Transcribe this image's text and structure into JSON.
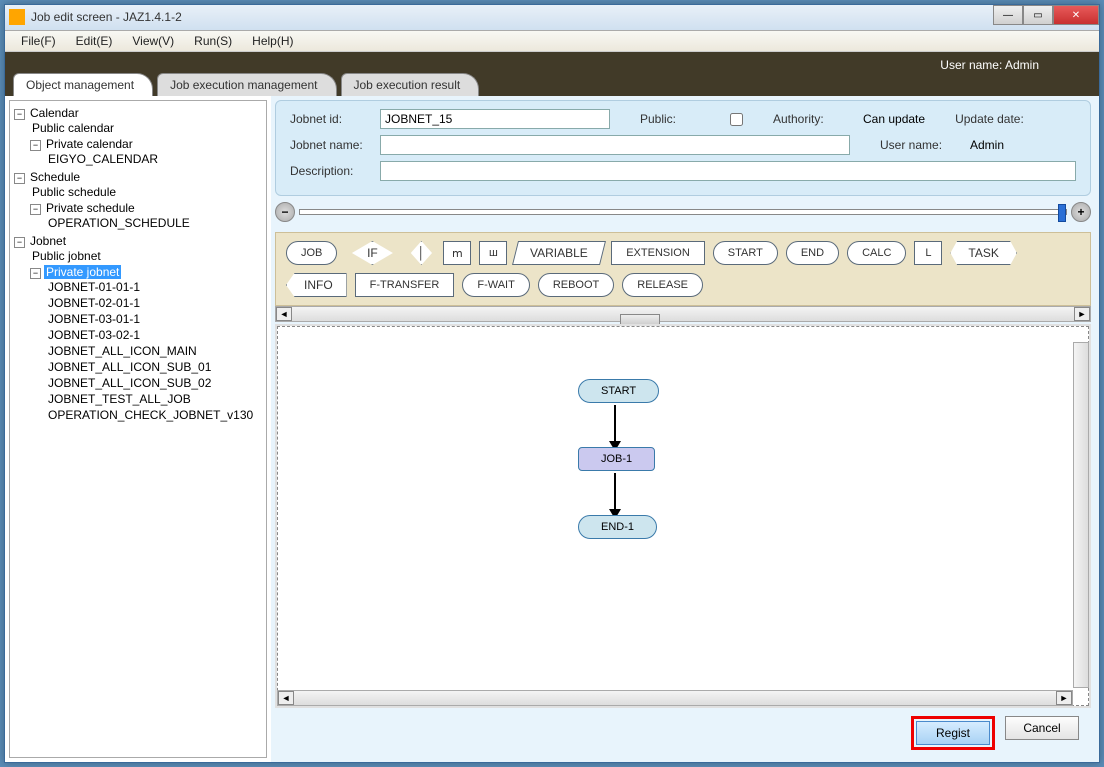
{
  "window": {
    "title": "Job edit screen - JAZ1.4.1-2"
  },
  "menu": {
    "file": "File(F)",
    "edit": "Edit(E)",
    "view": "View(V)",
    "run": "Run(S)",
    "help": "Help(H)"
  },
  "banner": {
    "user_label": "User name:",
    "user_value": "Admin"
  },
  "tabs": {
    "t1": "Object management",
    "t2": "Job execution management",
    "t3": "Job execution result"
  },
  "tree": {
    "calendar": "Calendar",
    "pub_cal": "Public calendar",
    "priv_cal": "Private calendar",
    "eigyo": "EIGYO_CALENDAR",
    "schedule": "Schedule",
    "pub_sched": "Public schedule",
    "priv_sched": "Private schedule",
    "op_sched": "OPERATION_SCHEDULE",
    "jobnet": "Jobnet",
    "pub_job": "Public jobnet",
    "priv_job": "Private jobnet",
    "j1": "JOBNET-01-01-1",
    "j2": "JOBNET-02-01-1",
    "j3": "JOBNET-03-01-1",
    "j4": "JOBNET-03-02-1",
    "j5": "JOBNET_ALL_ICON_MAIN",
    "j6": "JOBNET_ALL_ICON_SUB_01",
    "j7": "JOBNET_ALL_ICON_SUB_02",
    "j8": "JOBNET_TEST_ALL_JOB",
    "j9": "OPERATION_CHECK_JOBNET_v130"
  },
  "form": {
    "jobnet_id_label": "Jobnet id:",
    "jobnet_id": "JOBNET_15",
    "public_label": "Public:",
    "authority_label": "Authority:",
    "authority_value": "Can update",
    "update_label": "Update date:",
    "jobnet_name_label": "Jobnet name:",
    "jobnet_name": "",
    "user_label": "User name:",
    "user_value": "Admin",
    "desc_label": "Description:",
    "desc": ""
  },
  "palette": {
    "job": "JOB",
    "if": "IF",
    "vline": "│",
    "m": "ⅿ",
    "w": "ш",
    "variable": "VARIABLE",
    "extension": "EXTENSION",
    "start": "START",
    "end": "END",
    "calc": "CALC",
    "l": "L",
    "task": "TASK",
    "info": "INFO",
    "ftransfer": "F-TRANSFER",
    "fwait": "F-WAIT",
    "reboot": "REBOOT",
    "release": "RELEASE"
  },
  "flow": {
    "start": "START",
    "job": "JOB-1",
    "end": "END-1"
  },
  "buttons": {
    "regist": "Regist",
    "cancel": "Cancel"
  }
}
